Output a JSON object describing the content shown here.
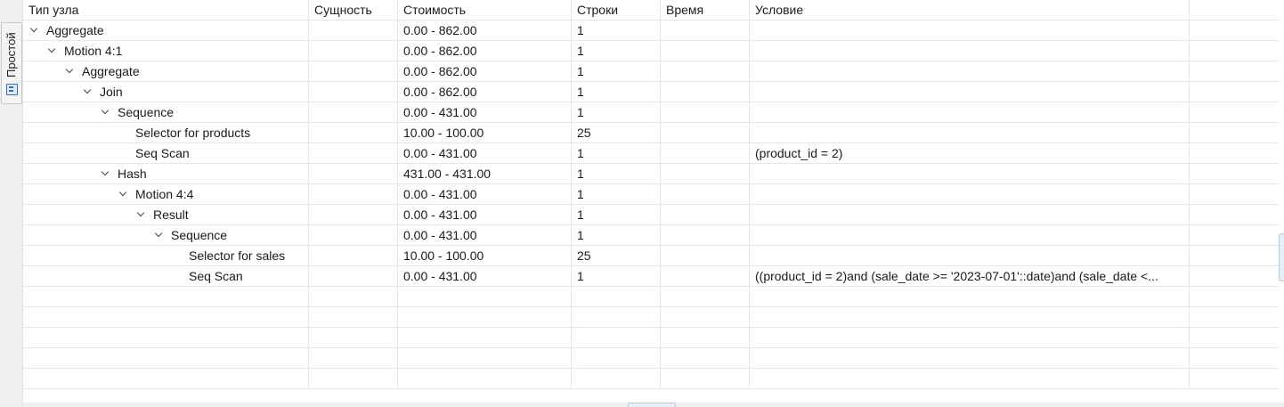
{
  "side_panel": {
    "tab_label": "Простой",
    "tab_icon": "plan-view-icon"
  },
  "columns": [
    "Тип узла",
    "Сущность",
    "Стоимость",
    "Строки",
    "Время",
    "Условие"
  ],
  "rows": [
    {
      "node": "Aggregate",
      "level": 0,
      "expanded": true,
      "entity": "",
      "cost": "0.00 - 862.00",
      "rows": "1",
      "time": "",
      "condition": ""
    },
    {
      "node": "Motion 4:1",
      "level": 1,
      "expanded": true,
      "entity": "",
      "cost": "0.00 - 862.00",
      "rows": "1",
      "time": "",
      "condition": ""
    },
    {
      "node": "Aggregate",
      "level": 2,
      "expanded": true,
      "entity": "",
      "cost": "0.00 - 862.00",
      "rows": "1",
      "time": "",
      "condition": ""
    },
    {
      "node": "Join",
      "level": 3,
      "expanded": true,
      "entity": "",
      "cost": "0.00 - 862.00",
      "rows": "1",
      "time": "",
      "condition": ""
    },
    {
      "node": "Sequence",
      "level": 4,
      "expanded": true,
      "entity": "",
      "cost": "0.00 - 431.00",
      "rows": "1",
      "time": "",
      "condition": ""
    },
    {
      "node": "Selector for products",
      "level": 5,
      "expanded": false,
      "entity": "",
      "cost": "10.00 - 100.00",
      "rows": "25",
      "time": "",
      "condition": ""
    },
    {
      "node": "Seq Scan",
      "level": 5,
      "expanded": false,
      "entity": "",
      "cost": "0.00 - 431.00",
      "rows": "1",
      "time": "",
      "condition": "(product_id = 2)"
    },
    {
      "node": "Hash",
      "level": 4,
      "expanded": true,
      "entity": "",
      "cost": "431.00 - 431.00",
      "rows": "1",
      "time": "",
      "condition": ""
    },
    {
      "node": "Motion 4:4",
      "level": 5,
      "expanded": true,
      "entity": "",
      "cost": "0.00 - 431.00",
      "rows": "1",
      "time": "",
      "condition": ""
    },
    {
      "node": "Result",
      "level": 6,
      "expanded": true,
      "entity": "",
      "cost": "0.00 - 431.00",
      "rows": "1",
      "time": "",
      "condition": ""
    },
    {
      "node": "Sequence",
      "level": 7,
      "expanded": true,
      "entity": "",
      "cost": "0.00 - 431.00",
      "rows": "1",
      "time": "",
      "condition": ""
    },
    {
      "node": "Selector for sales",
      "level": 8,
      "expanded": false,
      "entity": "",
      "cost": "10.00 - 100.00",
      "rows": "25",
      "time": "",
      "condition": ""
    },
    {
      "node": "Seq Scan",
      "level": 8,
      "expanded": false,
      "entity": "",
      "cost": "0.00 - 431.00",
      "rows": "1",
      "time": "",
      "condition": "((product_id = 2)and (sale_date >= '2023-07-01'::date)and (sale_date <..."
    }
  ],
  "empty_rows": 5
}
